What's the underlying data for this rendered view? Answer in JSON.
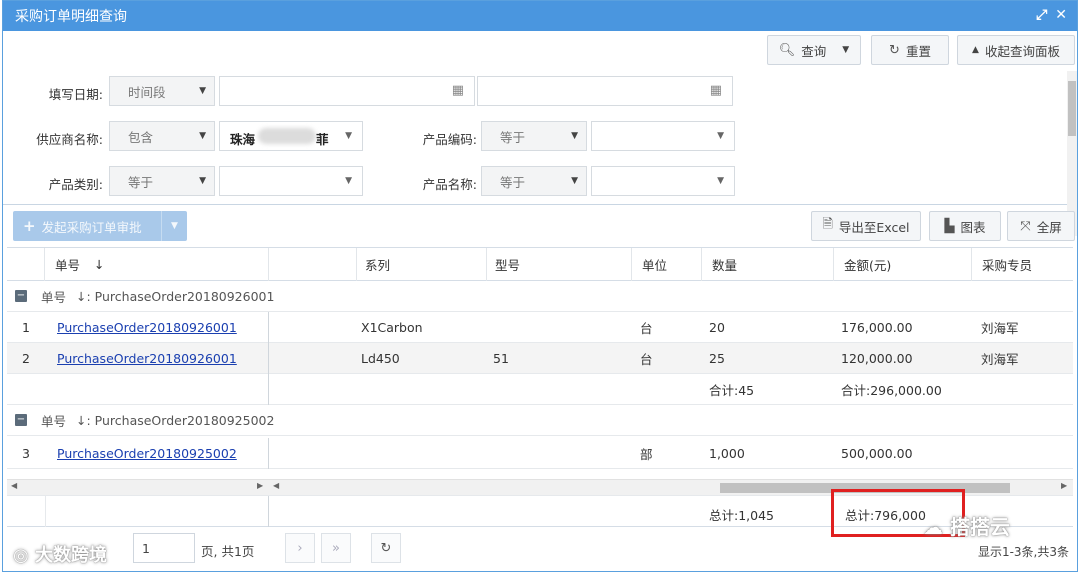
{
  "window": {
    "title": "采购订单明细查询"
  },
  "query": {
    "search_label": "查询",
    "reset_label": "重置",
    "collapse_label": "收起查询面板",
    "fill_date_label": "填写日期:",
    "fill_date_mode": "时间段",
    "supplier_label": "供应商名称:",
    "supplier_op": "包含",
    "supplier_value_start": "珠海",
    "supplier_value_end": "菲",
    "product_code_label": "产品编码:",
    "product_code_op": "等于",
    "product_category_label": "产品类别:",
    "product_category_op": "等于",
    "product_name_label": "产品名称:",
    "product_name_op": "等于"
  },
  "toolbar": {
    "approve_label": "发起采购订单审批",
    "export_label": "导出至Excel",
    "chart_label": "图表",
    "fullscreen_label": "全屏"
  },
  "grid": {
    "columns": [
      "单号",
      "系列",
      "型号",
      "单位",
      "数量",
      "金额(元)",
      "采购专员"
    ],
    "sort_glyph": "↓",
    "groups": [
      {
        "label": "单号",
        "value": "↓: PurchaseOrder20180926001",
        "rows": [
          {
            "no": "1",
            "order": "PurchaseOrder20180926001",
            "series": "X1Carbon",
            "model": "",
            "unit": "台",
            "qty": "20",
            "amount": "176,000.00",
            "buyer": "刘海军"
          },
          {
            "no": "2",
            "order": "PurchaseOrder20180926001",
            "series": "Ld450",
            "model": "51",
            "unit": "台",
            "qty": "25",
            "amount": "120,000.00",
            "buyer": "刘海军"
          }
        ],
        "subtotal_qty": "合计:45",
        "subtotal_amount": "合计:296,000.00"
      },
      {
        "label": "单号",
        "value": "↓: PurchaseOrder20180925002",
        "rows": [
          {
            "no": "3",
            "order": "PurchaseOrder20180925002",
            "series": "",
            "model": "",
            "unit": "部",
            "qty": "1,000",
            "amount": "500,000.00",
            "buyer": ""
          }
        ]
      }
    ],
    "total_qty": "总计:1,045",
    "total_amount": "总计:796,000"
  },
  "pager": {
    "page_value": "1",
    "page_suffix": "页, 共1页",
    "summary": "显示1-3条,共3条"
  },
  "watermarks": {
    "left": "大数跨境",
    "right": "搭搭云"
  },
  "colors": {
    "titlebar": "#4a96df",
    "link": "#1a3fb0",
    "highlight_box": "#e02020",
    "primary_button": "#a9c9ea"
  }
}
